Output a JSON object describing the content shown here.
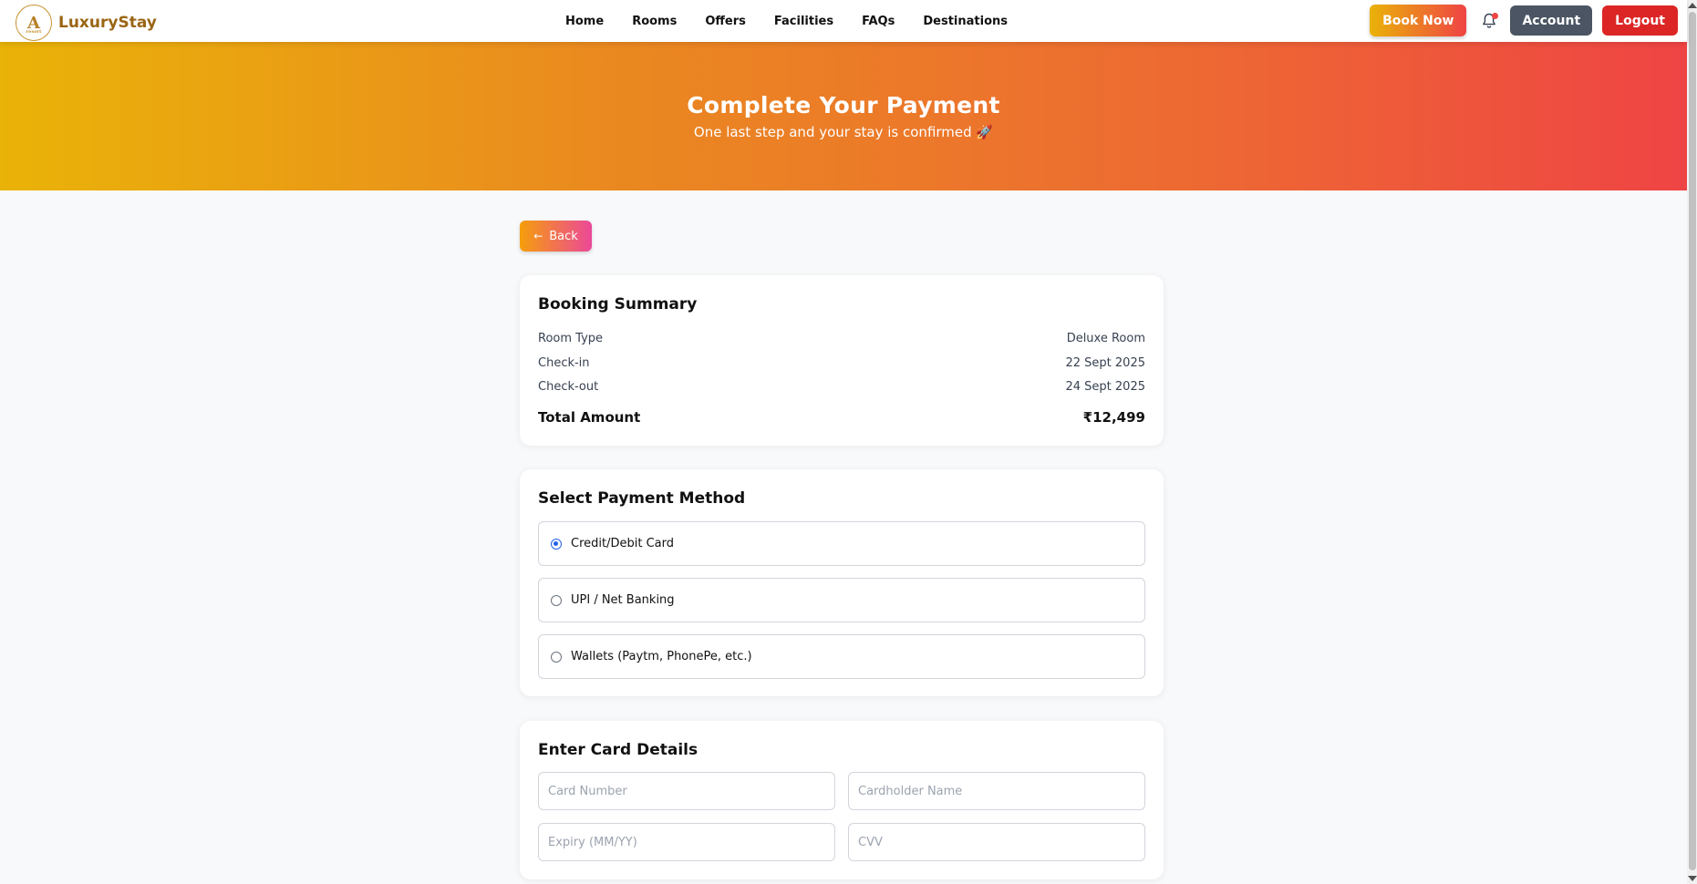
{
  "brand": {
    "name": "LuxuryStay",
    "logo_letter": "A",
    "logo_tagline": "resort"
  },
  "nav": {
    "links": [
      "Home",
      "Rooms",
      "Offers",
      "Facilities",
      "FAQs",
      "Destinations"
    ],
    "book_now": "Book Now",
    "account": "Account",
    "logout": "Logout",
    "bell_icon": "bell-icon"
  },
  "hero": {
    "title": "Complete Your Payment",
    "subtitle": "One last step and your stay is confirmed 🚀"
  },
  "back_label": "Back",
  "summary": {
    "title": "Booking Summary",
    "rows": [
      {
        "label": "Room Type",
        "value": "Deluxe Room"
      },
      {
        "label": "Check-in",
        "value": "22 Sept 2025"
      },
      {
        "label": "Check-out",
        "value": "24 Sept 2025"
      }
    ],
    "total_label": "Total Amount",
    "total_value": "₹12,499"
  },
  "payment": {
    "title": "Select Payment Method",
    "options": [
      {
        "label": "Credit/Debit Card",
        "selected": true
      },
      {
        "label": "UPI / Net Banking",
        "selected": false
      },
      {
        "label": "Wallets (Paytm, PhonePe, etc.)",
        "selected": false
      }
    ]
  },
  "card_details": {
    "title": "Enter Card Details",
    "card_number_placeholder": "Card Number",
    "cardholder_placeholder": "Cardholder Name",
    "expiry_placeholder": "Expiry (MM/YY)",
    "cvv_placeholder": "CVV"
  },
  "colors": {
    "brand_gold": "#9a6514",
    "hero_start": "#eab308",
    "hero_end": "#ef4444",
    "account_bg": "#4b5563",
    "logout_bg": "#dc2626",
    "radio_selected": "#2563eb"
  }
}
